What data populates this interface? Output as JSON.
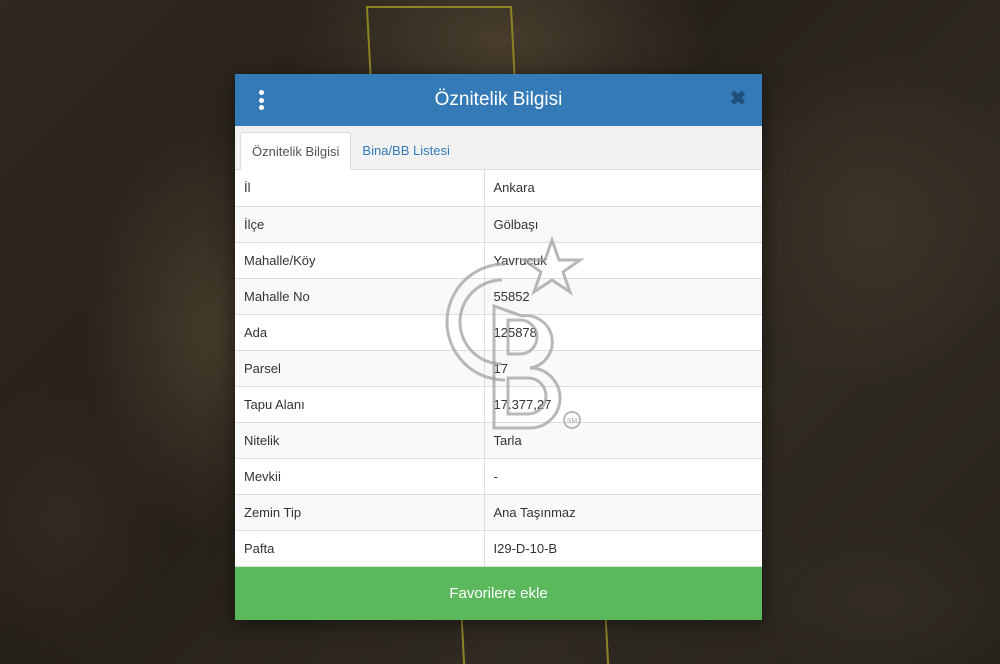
{
  "modal": {
    "title": "Öznitelik Bilgisi",
    "menu_icon": "kebab-menu-icon",
    "close_icon": "close-icon",
    "close_glyph": "✖"
  },
  "tabs": [
    {
      "label": "Öznitelik Bilgisi",
      "active": true
    },
    {
      "label": "Bina/BB Listesi",
      "active": false
    }
  ],
  "rows": [
    {
      "label": "İl",
      "value": "Ankara"
    },
    {
      "label": "İlçe",
      "value": "Gölbaşı"
    },
    {
      "label": "Mahalle/Köy",
      "value": "Yavrucuk"
    },
    {
      "label": "Mahalle No",
      "value": "55852"
    },
    {
      "label": "Ada",
      "value": "125878"
    },
    {
      "label": "Parsel",
      "value": "17"
    },
    {
      "label": "Tapu Alanı",
      "value": "17.377,27"
    },
    {
      "label": "Nitelik",
      "value": "Tarla"
    },
    {
      "label": "Mevkii",
      "value": "-"
    },
    {
      "label": "Zemin Tip",
      "value": "Ana Taşınmaz"
    },
    {
      "label": "Pafta",
      "value": "I29-D-10-B"
    }
  ],
  "footer": {
    "favorite_label": "Favorilere ekle"
  },
  "watermark": {
    "mark": "SM"
  },
  "colors": {
    "header": "#337ab7",
    "button": "#5cb85c",
    "parcel_outline": "#d9c93a"
  }
}
